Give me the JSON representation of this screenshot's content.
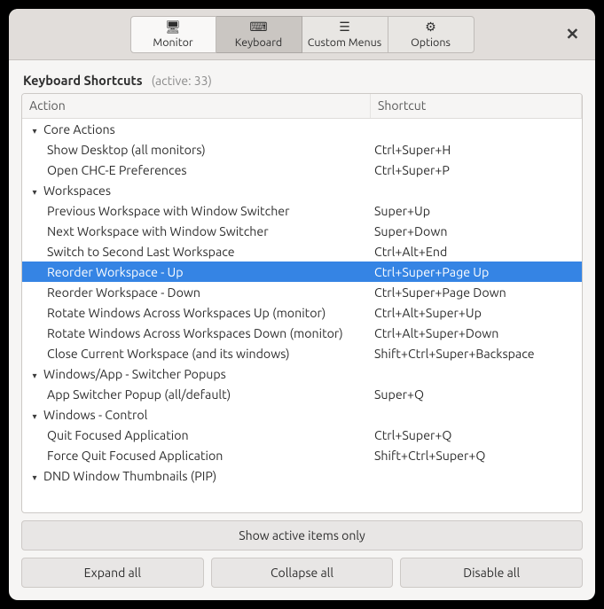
{
  "tabs": [
    {
      "label": "Monitor",
      "iconGlyph": "🖥",
      "active": false
    },
    {
      "label": "Keyboard",
      "iconGlyph": "⌨",
      "active": true
    },
    {
      "label": "Custom Menus",
      "iconGlyph": "☰",
      "active": false
    },
    {
      "label": "Options",
      "iconGlyph": "⚙",
      "active": false
    }
  ],
  "closeGlyph": "✕",
  "section": {
    "title": "Keyboard Shortcuts",
    "count": "(active: 33)"
  },
  "columns": {
    "action": "Action",
    "shortcut": "Shortcut"
  },
  "rows": [
    {
      "type": "group",
      "label": "Core Actions"
    },
    {
      "type": "item",
      "label": "Show Desktop (all monitors)",
      "shortcut": "Ctrl+Super+H"
    },
    {
      "type": "item",
      "label": "Open CHC-E Preferences",
      "shortcut": "Ctrl+Super+P"
    },
    {
      "type": "group",
      "label": "Workspaces"
    },
    {
      "type": "item",
      "label": "Previous Workspace with Window Switcher",
      "shortcut": "Super+Up"
    },
    {
      "type": "item",
      "label": "Next Workspace with Window Switcher",
      "shortcut": "Super+Down"
    },
    {
      "type": "item",
      "label": "Switch to Second Last Workspace",
      "shortcut": "Ctrl+Alt+End"
    },
    {
      "type": "item",
      "label": "Reorder Workspace - Up",
      "shortcut": "Ctrl+Super+Page Up",
      "selected": true
    },
    {
      "type": "item",
      "label": "Reorder Workspace - Down",
      "shortcut": "Ctrl+Super+Page Down"
    },
    {
      "type": "item",
      "label": "Rotate Windows Across Workspaces Up (monitor)",
      "shortcut": "Ctrl+Alt+Super+Up"
    },
    {
      "type": "item",
      "label": "Rotate Windows Across Workspaces Down (monitor)",
      "shortcut": "Ctrl+Alt+Super+Down"
    },
    {
      "type": "item",
      "label": "Close Current Workspace (and its windows)",
      "shortcut": "Shift+Ctrl+Super+Backspace"
    },
    {
      "type": "group",
      "label": "Windows/App - Switcher Popups"
    },
    {
      "type": "item",
      "label": "App Switcher Popup (all/default)",
      "shortcut": "Super+Q"
    },
    {
      "type": "group",
      "label": "Windows - Control"
    },
    {
      "type": "item",
      "label": "Quit Focused Application",
      "shortcut": "Ctrl+Super+Q"
    },
    {
      "type": "item",
      "label": "Force Quit Focused Application",
      "shortcut": "Shift+Ctrl+Super+Q"
    },
    {
      "type": "group",
      "label": "DND Window Thumbnails (PIP)"
    }
  ],
  "buttons": {
    "showActive": "Show active items only",
    "expand": "Expand all",
    "collapse": "Collapse all",
    "disable": "Disable all"
  },
  "expanderGlyph": "▾"
}
